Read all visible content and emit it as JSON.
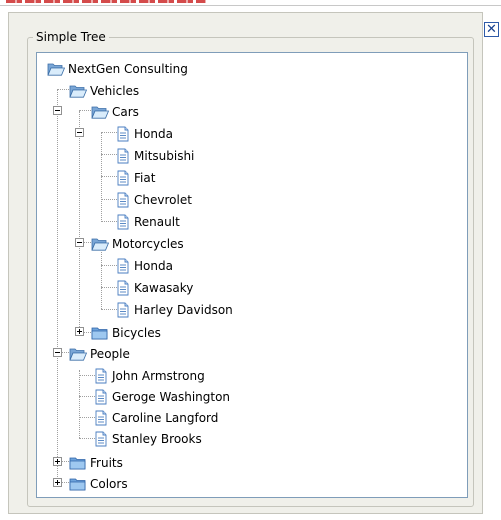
{
  "window": {
    "close_label": "✕"
  },
  "group": {
    "legend": "Simple Tree"
  },
  "tree": {
    "root": "NextGen Consulting",
    "vehicles": {
      "label": "Vehicles",
      "cars": {
        "label": "Cars",
        "items": [
          "Honda",
          "Mitsubishi",
          "Fiat",
          "Chevrolet",
          "Renault"
        ]
      },
      "motorcycles": {
        "label": "Motorcycles",
        "items": [
          "Honda",
          "Kawasaky",
          "Harley Davidson"
        ]
      },
      "bicycles": {
        "label": "Bicycles"
      }
    },
    "people": {
      "label": "People",
      "items": [
        "John Armstrong",
        "Geroge Washington",
        "Caroline Langford",
        "Stanley Brooks"
      ]
    },
    "fruits": {
      "label": "Fruits"
    },
    "colors": {
      "label": "Colors"
    }
  }
}
